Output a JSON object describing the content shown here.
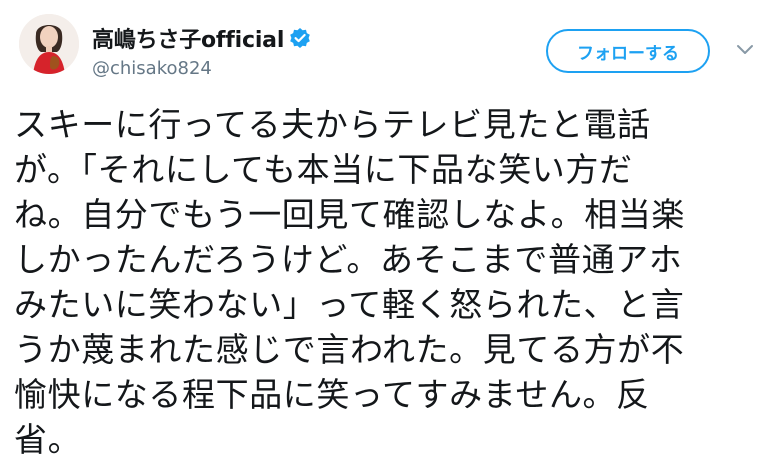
{
  "user": {
    "display_name": "高嶋ちさ子official",
    "handle": "@chisako824",
    "verified_icon": "verified-badge-icon",
    "avatar_icon": "profile-photo"
  },
  "actions": {
    "follow_label": "フォローする",
    "menu_icon": "chevron-down-icon"
  },
  "colors": {
    "accent": "#1da1f2",
    "secondary_text": "#657786",
    "primary_text": "#14171a"
  },
  "tweet": {
    "lines": [
      "スキーに行ってる夫からテレビ見たと電話",
      "が。「それにしても本当に下品な笑い方だ",
      "ね。自分でもう一回見て確認しなよ。相当楽",
      "しかったんだろうけど。あそこまで普通アホ",
      "みたいに笑わない」って軽く怒られた、と言",
      "うか蔑まれた感じで言われた。見てる方が不",
      "愉快になる程下品に笑ってすみません。反",
      "省。"
    ]
  }
}
